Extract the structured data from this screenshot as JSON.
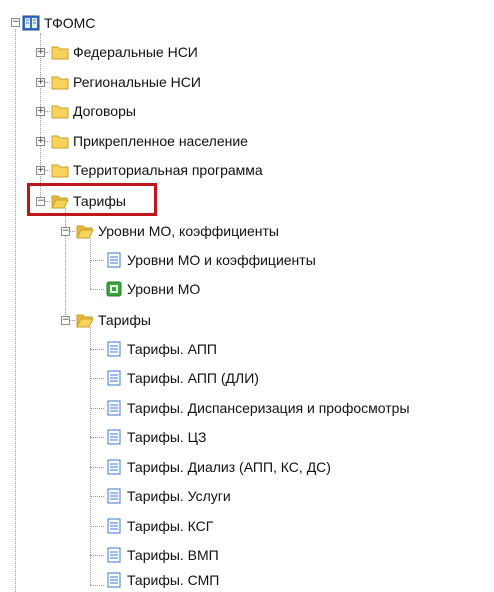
{
  "tree": {
    "root": {
      "label": "ТФОМС",
      "icon": "database-icon"
    },
    "nodes": [
      {
        "label": "Федеральные НСИ",
        "icon": "folder-closed-icon"
      },
      {
        "label": "Региональные НСИ",
        "icon": "folder-closed-icon"
      },
      {
        "label": "Договоры",
        "icon": "folder-closed-icon"
      },
      {
        "label": "Прикрепленное население",
        "icon": "folder-closed-icon"
      },
      {
        "label": "Территориальная программа",
        "icon": "folder-closed-icon"
      },
      {
        "label": "Тарифы",
        "icon": "folder-open-icon"
      },
      {
        "label": "Уровни МО, коэффициенты",
        "icon": "folder-open-icon"
      },
      {
        "label": "Уровни МО и коэффициенты",
        "icon": "document-icon"
      },
      {
        "label": "Уровни МО",
        "icon": "report-icon"
      },
      {
        "label": "Тарифы",
        "icon": "folder-open-icon"
      },
      {
        "label": "Тарифы. АПП",
        "icon": "document-icon"
      },
      {
        "label": "Тарифы. АПП (ДЛИ)",
        "icon": "document-icon"
      },
      {
        "label": "Тарифы. Диспансеризация и профосмотры",
        "icon": "document-icon"
      },
      {
        "label": "Тарифы. ЦЗ",
        "icon": "document-icon"
      },
      {
        "label": "Тарифы. Диализ (АПП, КС, ДС)",
        "icon": "document-icon"
      },
      {
        "label": "Тарифы. Услуги",
        "icon": "document-icon"
      },
      {
        "label": "Тарифы. КСГ",
        "icon": "document-icon"
      },
      {
        "label": "Тарифы. ВМП",
        "icon": "document-icon"
      },
      {
        "label": "Тарифы. СМП",
        "icon": "document-icon"
      }
    ],
    "expander_collapsed": "+",
    "expander_expanded": "−",
    "highlight_color": "#c0161b"
  }
}
